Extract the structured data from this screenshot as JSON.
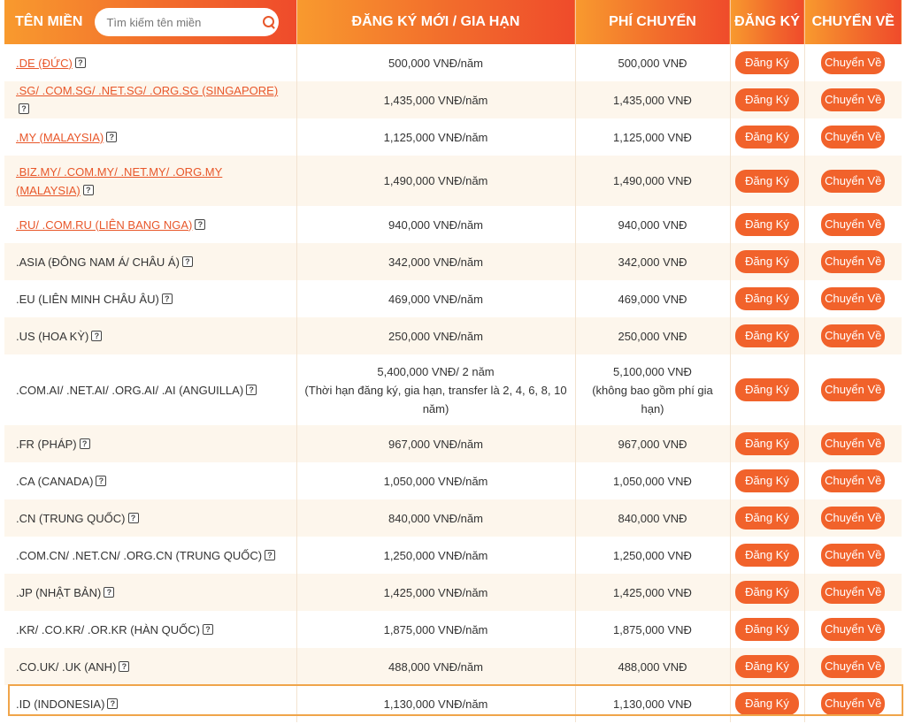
{
  "header": {
    "col_domain": "TÊN MIỀN",
    "search_placeholder": "Tìm kiếm tên miền",
    "col_register": "ĐĂNG KÝ MỚI / GIA HẠN",
    "col_transfer_fee": "PHÍ CHUYỂN",
    "col_action_register": "ĐĂNG KÝ",
    "col_action_transfer": "CHUYỂN VỀ"
  },
  "buttons": {
    "register": "Đăng Ký",
    "transfer": "Chuyển Về"
  },
  "icons": {
    "search": "search-icon",
    "help": "help-icon",
    "help_glyph": "?"
  },
  "colors": {
    "accent": "#f1622b",
    "highlight": "#f0a54a"
  },
  "rows": [
    {
      "domain": ".DE (ĐỨC)",
      "linked": true,
      "price": "500,000 VNĐ/năm",
      "price_note": "",
      "transfer": "500,000 VNĐ",
      "transfer_note": ""
    },
    {
      "domain": ".SG/ .COM.SG/ .NET.SG/ .ORG.SG (SINGAPORE)",
      "linked": true,
      "price": "1,435,000 VNĐ/năm",
      "price_note": "",
      "transfer": "1,435,000 VNĐ",
      "transfer_note": ""
    },
    {
      "domain": ".MY (MALAYSIA)",
      "linked": true,
      "price": "1,125,000 VNĐ/năm",
      "price_note": "",
      "transfer": "1,125,000 VNĐ",
      "transfer_note": ""
    },
    {
      "domain": ".BIZ.MY/ .COM.MY/ .NET.MY/ .ORG.MY (MALAYSIA)",
      "linked": true,
      "price": "1,490,000 VNĐ/năm",
      "price_note": "",
      "transfer": "1,490,000 VNĐ",
      "transfer_note": ""
    },
    {
      "domain": ".RU/ .COM.RU (LIÊN BANG NGA)",
      "linked": true,
      "price": "940,000 VNĐ/năm",
      "price_note": "",
      "transfer": "940,000 VNĐ",
      "transfer_note": ""
    },
    {
      "domain": ".ASIA (ĐÔNG NAM Á/ CHÂU Á)",
      "linked": false,
      "price": "342,000 VNĐ/năm",
      "price_note": "",
      "transfer": "342,000 VNĐ",
      "transfer_note": ""
    },
    {
      "domain": ".EU (LIÊN MINH CHÂU ÂU)",
      "linked": false,
      "price": "469,000 VNĐ/năm",
      "price_note": "",
      "transfer": "469,000 VNĐ",
      "transfer_note": ""
    },
    {
      "domain": ".US (HOA KỲ)",
      "linked": false,
      "price": "250,000 VNĐ/năm",
      "price_note": "",
      "transfer": "250,000 VNĐ",
      "transfer_note": ""
    },
    {
      "domain": ".COM.AI/ .NET.AI/ .ORG.AI/ .AI (ANGUILLA)",
      "linked": false,
      "price": "5,400,000 VNĐ/ 2 năm",
      "price_note": "(Thời hạn đăng ký, gia hạn, transfer là 2, 4, 6, 8, 10 năm)",
      "transfer": "5,100,000 VNĐ",
      "transfer_note": "(không bao gồm phí gia hạn)"
    },
    {
      "domain": ".FR (PHÁP)",
      "linked": false,
      "price": "967,000 VNĐ/năm",
      "price_note": "",
      "transfer": "967,000 VNĐ",
      "transfer_note": ""
    },
    {
      "domain": ".CA (CANADA)",
      "linked": false,
      "price": "1,050,000 VNĐ/năm",
      "price_note": "",
      "transfer": "1,050,000 VNĐ",
      "transfer_note": ""
    },
    {
      "domain": ".CN (TRUNG QUỐC)",
      "linked": false,
      "price": "840,000 VNĐ/năm",
      "price_note": "",
      "transfer": "840,000 VNĐ",
      "transfer_note": ""
    },
    {
      "domain": ".COM.CN/ .NET.CN/ .ORG.CN (TRUNG QUỐC)",
      "linked": false,
      "price": "1,250,000 VNĐ/năm",
      "price_note": "",
      "transfer": "1,250,000 VNĐ",
      "transfer_note": ""
    },
    {
      "domain": ".JP (NHẬT BẢN)",
      "linked": false,
      "price": "1,425,000 VNĐ/năm",
      "price_note": "",
      "transfer": "1,425,000 VNĐ",
      "transfer_note": ""
    },
    {
      "domain": ".KR/ .CO.KR/ .OR.KR (HÀN QUỐC)",
      "linked": false,
      "price": "1,875,000 VNĐ/năm",
      "price_note": "",
      "transfer": "1,875,000 VNĐ",
      "transfer_note": ""
    },
    {
      "domain": ".CO.UK/ .UK (ANH)",
      "linked": false,
      "price": "488,000 VNĐ/năm",
      "price_note": "",
      "transfer": "488,000 VNĐ",
      "transfer_note": ""
    },
    {
      "domain": ".ID (INDONESIA)",
      "linked": false,
      "price": "1,130,000 VNĐ/năm",
      "price_note": "",
      "transfer": "1,130,000 VNĐ",
      "transfer_note": "",
      "highlighted": true
    }
  ]
}
